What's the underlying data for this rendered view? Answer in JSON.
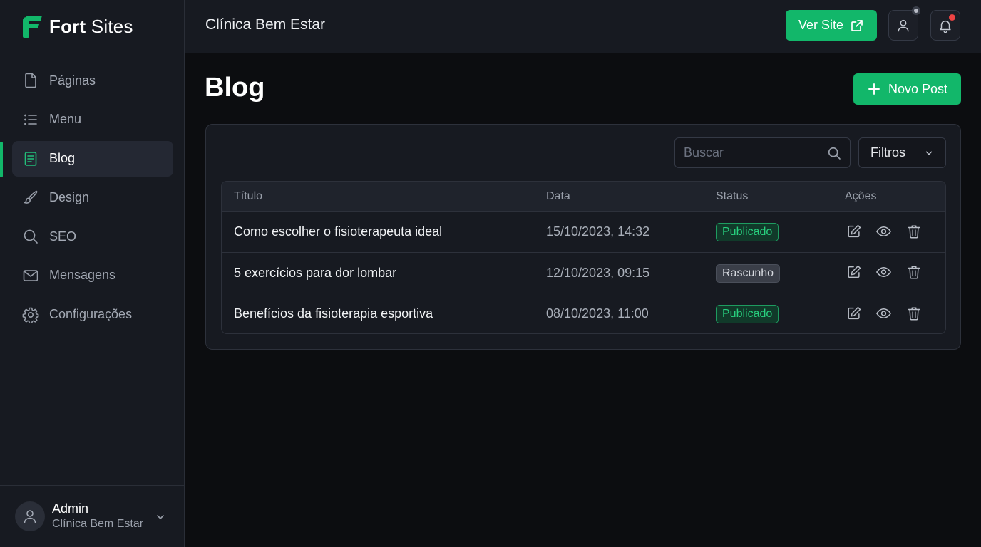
{
  "brand": {
    "name_bold": "Fort",
    "name_light": "Sites"
  },
  "sidebar": {
    "items": [
      {
        "label": "Páginas",
        "icon": "file-icon",
        "active": false
      },
      {
        "label": "Menu",
        "icon": "list-icon",
        "active": false
      },
      {
        "label": "Blog",
        "icon": "document-text-icon",
        "active": true
      },
      {
        "label": "Design",
        "icon": "brush-icon",
        "active": false
      },
      {
        "label": "SEO",
        "icon": "search-icon",
        "active": false
      },
      {
        "label": "Mensagens",
        "icon": "mail-icon",
        "active": false
      },
      {
        "label": "Configurações",
        "icon": "gear-icon",
        "active": false
      }
    ],
    "user": {
      "name": "Admin",
      "org": "Clínica Bem Estar"
    }
  },
  "header": {
    "title": "Clínica Bem Estar",
    "view_site_label": "Ver Site"
  },
  "main": {
    "title": "Blog",
    "new_post_label": "Novo Post",
    "search": {
      "placeholder": "Buscar",
      "value": ""
    },
    "filter_label": "Filtros",
    "table": {
      "columns": [
        "Título",
        "Data",
        "Status",
        "Ações"
      ],
      "rows": [
        {
          "title": "Como escolher o fisioterapeuta ideal",
          "date": "15/10/2023, 14:32",
          "status": "Publicado",
          "status_type": "published"
        },
        {
          "title": "5 exercícios para dor lombar",
          "date": "12/10/2023, 09:15",
          "status": "Rascunho",
          "status_type": "draft"
        },
        {
          "title": "Benefícios da fisioterapia esportiva",
          "date": "08/10/2023, 11:00",
          "status": "Publicado",
          "status_type": "published"
        }
      ]
    }
  },
  "colors": {
    "accent": "#12b76a",
    "background": "#0c0d10",
    "panel": "#171a21",
    "notification": "#ef4444"
  }
}
